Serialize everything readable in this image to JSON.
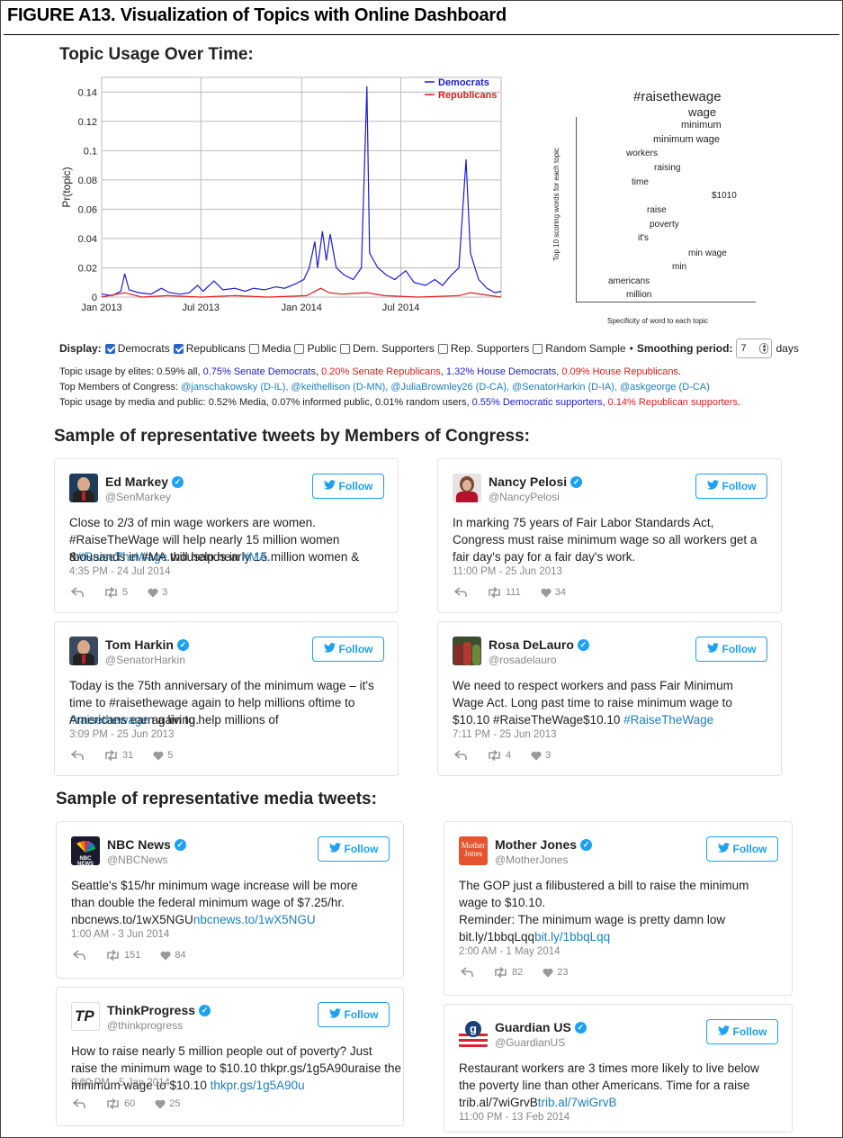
{
  "figure_title": "FIGURE A13. Visualization of Topics with Online Dashboard",
  "section1_title": "Topic Usage Over Time:",
  "chart_data": {
    "type": "line",
    "title": "",
    "xlabel": "",
    "ylabel": "Pr(topic)",
    "ylim": [
      0,
      0.15
    ],
    "x_ticks": [
      "Jan 2013",
      "Jul 2013",
      "Jan 2014",
      "Jul 2014"
    ],
    "y_ticks": [
      "0",
      "0.02",
      "0.04",
      "0.06",
      "0.08",
      "0.1",
      "0.12",
      "0.14"
    ],
    "legend_position": "top-right",
    "grid": true,
    "series": [
      {
        "name": "Democrats",
        "color": "#1c1cd6",
        "points": [
          [
            "2013-01-01",
            0.002
          ],
          [
            "2013-01-20",
            0.001
          ],
          [
            "2013-02-05",
            0.004
          ],
          [
            "2013-02-12",
            0.016
          ],
          [
            "2013-02-20",
            0.005
          ],
          [
            "2013-03-10",
            0.003
          ],
          [
            "2013-04-01",
            0.002
          ],
          [
            "2013-04-20",
            0.006
          ],
          [
            "2013-05-05",
            0.003
          ],
          [
            "2013-05-25",
            0.002
          ],
          [
            "2013-06-10",
            0.003
          ],
          [
            "2013-06-25",
            0.008
          ],
          [
            "2013-07-05",
            0.004
          ],
          [
            "2013-07-25",
            0.011
          ],
          [
            "2013-08-10",
            0.005
          ],
          [
            "2013-09-01",
            0.006
          ],
          [
            "2013-09-20",
            0.004
          ],
          [
            "2013-10-05",
            0.006
          ],
          [
            "2013-10-25",
            0.005
          ],
          [
            "2013-11-15",
            0.007
          ],
          [
            "2013-12-01",
            0.006
          ],
          [
            "2013-12-20",
            0.009
          ],
          [
            "2014-01-05",
            0.012
          ],
          [
            "2014-01-15",
            0.02
          ],
          [
            "2014-01-25",
            0.038
          ],
          [
            "2014-01-30",
            0.02
          ],
          [
            "2014-02-08",
            0.045
          ],
          [
            "2014-02-15",
            0.025
          ],
          [
            "2014-02-22",
            0.043
          ],
          [
            "2014-03-05",
            0.02
          ],
          [
            "2014-03-20",
            0.015
          ],
          [
            "2014-04-05",
            0.012
          ],
          [
            "2014-04-20",
            0.02
          ],
          [
            "2014-04-30",
            0.144
          ],
          [
            "2014-05-05",
            0.03
          ],
          [
            "2014-05-20",
            0.02
          ],
          [
            "2014-06-05",
            0.015
          ],
          [
            "2014-06-20",
            0.012
          ],
          [
            "2014-07-10",
            0.018
          ],
          [
            "2014-07-25",
            0.01
          ],
          [
            "2014-08-15",
            0.008
          ],
          [
            "2014-09-01",
            0.012
          ],
          [
            "2014-09-15",
            0.008
          ],
          [
            "2014-10-01",
            0.015
          ],
          [
            "2014-10-15",
            0.02
          ],
          [
            "2014-10-28",
            0.094
          ],
          [
            "2014-11-05",
            0.03
          ],
          [
            "2014-11-20",
            0.012
          ],
          [
            "2014-12-05",
            0.006
          ],
          [
            "2014-12-20",
            0.003
          ],
          [
            "2014-12-31",
            0.004
          ]
        ]
      },
      {
        "name": "Republicans",
        "color": "#e01b1b",
        "points": [
          [
            "2013-01-01",
            0.0
          ],
          [
            "2013-02-12",
            0.003
          ],
          [
            "2013-03-15",
            0.0
          ],
          [
            "2013-05-01",
            0.001
          ],
          [
            "2013-07-01",
            0.0
          ],
          [
            "2013-09-01",
            0.001
          ],
          [
            "2013-11-01",
            0.0
          ],
          [
            "2014-01-10",
            0.001
          ],
          [
            "2014-02-05",
            0.006
          ],
          [
            "2014-02-20",
            0.003
          ],
          [
            "2014-03-15",
            0.002
          ],
          [
            "2014-04-30",
            0.003
          ],
          [
            "2014-06-01",
            0.001
          ],
          [
            "2014-08-01",
            0.0
          ],
          [
            "2014-10-15",
            0.001
          ],
          [
            "2014-11-05",
            0.003
          ],
          [
            "2014-12-31",
            0.0
          ]
        ]
      }
    ]
  },
  "word_cloud": {
    "title": "#raisethewage",
    "ylabel": "Top 10 scoring words for each topic",
    "xlabel": "Specificity of word to each topic",
    "words": [
      "wage",
      "minimum",
      "minimum wage",
      "workers",
      "raising",
      "time",
      "$1010",
      "raise",
      "poverty",
      "it's",
      "min wage",
      "min",
      "americans",
      "million"
    ]
  },
  "controls": {
    "display_label": "Display:",
    "options": [
      {
        "label": "Democrats",
        "checked": true
      },
      {
        "label": "Republicans",
        "checked": true
      },
      {
        "label": "Media",
        "checked": false
      },
      {
        "label": "Public",
        "checked": false
      },
      {
        "label": "Dem. Supporters",
        "checked": false
      },
      {
        "label": "Rep. Supporters",
        "checked": false
      },
      {
        "label": "Random Sample",
        "checked": false
      }
    ],
    "bullet": "•",
    "smoothing_label": "Smoothing period:",
    "smoothing_value": "7",
    "smoothing_unit": "days"
  },
  "info": {
    "elites_prefix": "Topic usage by elites: 0.59% all, ",
    "elites_sen_dem": "0.75% Senate Democrats",
    "sep1": ", ",
    "elites_sen_rep": "0.20% Senate Republicans",
    "sep2": ", ",
    "elites_house_dem": "1.32% House Democrats",
    "sep3": ", ",
    "elites_house_rep": "0.09% House Republicans",
    "elites_end": ".",
    "top_members_label": "Top Members of Congress: ",
    "top_members": "@janschakowsky (D-IL), @keithellison (D-MN), @JuliaBrownley26 (D-CA), @SenatorHarkin (D-IA), @askgeorge (D-CA)",
    "media_prefix": "Topic usage by media and public: 0.52% Media, 0.07% informed public, 0.01% random users, ",
    "media_dem_supp": "0.55% Democratic supporters",
    "sep4": ", ",
    "media_rep_supp": "0.14% Republican supporters",
    "media_end": "."
  },
  "section2_title": "Sample of representative tweets by Members of Congress:",
  "section3_title": "Sample of representative media tweets:",
  "follow_label": "Follow",
  "verified_glyph": "✓",
  "congress_tweets": [
    {
      "name": "Ed Markey",
      "handle": "@SenMarkey",
      "lines": [
        "Close to 2/3 of min wage workers are women.",
        "#RaiseTheWage will help nearly 15 million women &",
        "thousands in #MA."
      ],
      "time": "4:35 PM - 24 Jul 2014",
      "retweets": "5",
      "likes": "3"
    },
    {
      "name": "Nancy Pelosi",
      "handle": "@NancyPelosi",
      "lines": [
        "In marking 75 years of Fair Labor Standards Act,",
        "Congress must raise minimum wage so all workers get a",
        "fair day's pay for a fair day's work."
      ],
      "time": "11:00 PM - 25 Jun 2013",
      "retweets": "111",
      "likes": "34"
    },
    {
      "name": "Tom Harkin",
      "handle": "@SenatorHarkin",
      "lines": [
        "Today is the 75th anniversary of the minimum wage – it's",
        "time to #raisethewage again to help millions of",
        "Americans earn a living."
      ],
      "time": "3:09 PM - 25 Jun 2013",
      "retweets": "31",
      "likes": "5"
    },
    {
      "name": "Rosa DeLauro",
      "handle": "@rosadelauro",
      "lines": [
        "We need to respect workers and pass Fair Minimum",
        "Wage Act. Long past time to raise minimum wage to",
        "$10.10 #RaiseTheWage"
      ],
      "time": "7:11 PM - 25 Jun 2013",
      "retweets": "4",
      "likes": "3"
    }
  ],
  "media_tweets": [
    {
      "name": "NBC News",
      "handle": "@NBCNews",
      "logo_text": "NBC NEWS",
      "lines": [
        "Seattle's $15/hr minimum wage increase will be more",
        "than double the federal minimum wage of $7.25/hr.",
        "nbcnews.to/1wX5NGU"
      ],
      "time": "1:00 AM - 3 Jun 2014",
      "retweets": "151",
      "likes": "84"
    },
    {
      "name": "Mother Jones",
      "handle": "@MotherJones",
      "logo_text": "Mother Jones",
      "lines": [
        "The GOP just a filibustered a bill to raise the minimum",
        "wage to $10.10.",
        "Reminder: The minimum wage is pretty damn low",
        "bit.ly/1bbqLqq"
      ],
      "time": "2:00 AM - 1 May 2014",
      "retweets": "82",
      "likes": "23"
    },
    {
      "name": "ThinkProgress",
      "handle": "@thinkprogress",
      "logo_text": "TP",
      "lines": [
        "How to raise nearly 5 million people out of poverty? Just",
        "raise the minimum wage to $10.10 thkpr.gs/1g5A90u"
      ],
      "time": "9:00 PM - 5 Jan 2014",
      "retweets": "60",
      "likes": "25"
    },
    {
      "name": "Guardian US",
      "handle": "@GuardianUS",
      "lines": [
        "Restaurant workers are 3 times more likely to live below",
        "the poverty line than other Americans. Time for a raise",
        "trib.al/7wiGrvB"
      ],
      "time": "11:00 PM - 13 Feb 2014"
    }
  ],
  "icons": [
    "reply-icon",
    "retweet-icon",
    "heart-icon",
    "twitter-bird-icon",
    "verified-badge-icon"
  ],
  "colors": {
    "democrats": "#1c1cd6",
    "republicans": "#e01b1b",
    "twitter_blue": "#1da1f2",
    "link": "#1b7fc1"
  }
}
